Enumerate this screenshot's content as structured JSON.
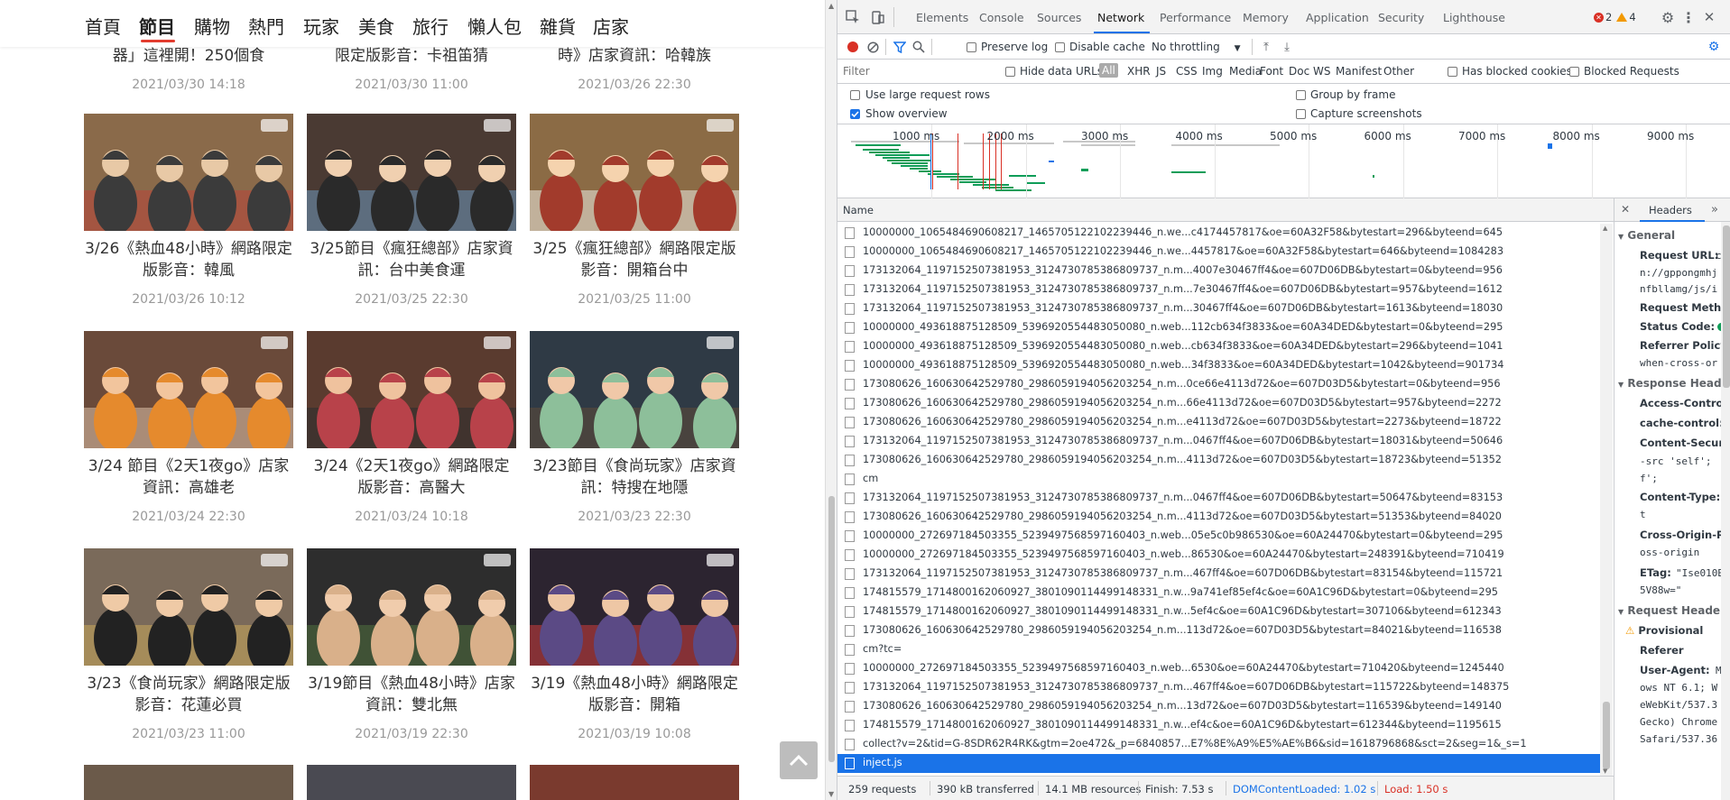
{
  "nav": {
    "items": [
      "首頁",
      "節目",
      "購物",
      "熱門",
      "玩家",
      "美食",
      "旅行",
      "懶人包",
      "雜貨",
      "店家"
    ],
    "active_index": 1
  },
  "cards": [
    {
      "title": "器」這裡開！250個食",
      "date": "2021/03/30 14:18",
      "partial": true
    },
    {
      "title": "限定版影音：卡祖笛猜",
      "date": "2021/03/30 11:00",
      "partial": true
    },
    {
      "title": "時》店家資訊：哈韓族",
      "date": "2021/03/26 22:30",
      "partial": true
    },
    {
      "title": "3/26《熱血48小時》網路限定版影音：韓風",
      "date": "2021/03/26 10:12"
    },
    {
      "title": "3/25節目《瘋狂總部》店家資訊：台中美食運",
      "date": "2021/03/25 22:30"
    },
    {
      "title": "3/25《瘋狂總部》網路限定版影音：開箱台中",
      "date": "2021/03/25 11:00"
    },
    {
      "title": "3/24 節目《2天1夜go》店家資訊：高雄老",
      "date": "2021/03/24 22:30"
    },
    {
      "title": "3/24《2天1夜go》網路限定版影音：高醫大",
      "date": "2021/03/24 10:18"
    },
    {
      "title": "3/23節目《食尚玩家》店家資訊：特搜在地隱",
      "date": "2021/03/23 22:30"
    },
    {
      "title": "3/23《食尚玩家》網路限定版影音：花蓮必買",
      "date": "2021/03/23 11:00"
    },
    {
      "title": "3/19節目《熱血48小時》店家資訊：雙北無",
      "date": "2021/03/19 22:30"
    },
    {
      "title": "3/19《熱血48小時》網路限定版影音：開箱",
      "date": "2021/03/19 10:08"
    }
  ],
  "devtools": {
    "tabs": [
      "Elements",
      "Console",
      "Sources",
      "Network",
      "Performance",
      "Memory",
      "Application",
      "Security",
      "Lighthouse"
    ],
    "active_tab": "Network",
    "error_count": "2",
    "warning_count": "4",
    "toolbar": {
      "preserve_log": "Preserve log",
      "disable_cache": "Disable cache",
      "throttling": "No throttling"
    },
    "filter": {
      "placeholder": "Filter",
      "hide_data_urls": "Hide data URLs",
      "types": [
        "All",
        "XHR",
        "JS",
        "CSS",
        "Img",
        "Media",
        "Font",
        "Doc",
        "WS",
        "Manifest",
        "Other"
      ],
      "has_blocked_cookies": "Has blocked cookies",
      "blocked_requests": "Blocked Requests"
    },
    "options": {
      "large_rows": "Use large request rows",
      "group_by_frame": "Group by frame",
      "show_overview": "Show overview",
      "capture_screenshots": "Capture screenshots"
    },
    "overview_ticks": [
      "1000 ms",
      "2000 ms",
      "3000 ms",
      "4000 ms",
      "5000 ms",
      "6000 ms",
      "7000 ms",
      "8000 ms",
      "9000 ms"
    ],
    "column_name": "Name",
    "requests": [
      "10000000_1065484690608217_1465705122102239446_n.we...c4174457817&oe=60A32F58&bytestart=296&byteend=645",
      "10000000_1065484690608217_1465705122102239446_n.we...4457817&oe=60A32F58&bytestart=646&byteend=1084283",
      "173132064_1197152507381953_3124730785386809737_n.m...4007e30467ff4&oe=607D06DB&bytestart=0&byteend=956",
      "173132064_1197152507381953_3124730785386809737_n.m...7e30467ff4&oe=607D06DB&bytestart=957&byteend=1612",
      "173132064_1197152507381953_3124730785386809737_n.m...30467ff4&oe=607D06DB&bytestart=1613&byteend=18030",
      "10000000_493618875128509_5396920554483050080_n.web...112cb634f3833&oe=60A34DED&bytestart=0&byteend=295",
      "10000000_493618875128509_5396920554483050080_n.web...cb634f3833&oe=60A34DED&bytestart=296&byteend=1041",
      "10000000_493618875128509_5396920554483050080_n.web...34f3833&oe=60A34DED&bytestart=1042&byteend=901734",
      "173080626_160630642529780_2986059194056203254_n.m...0ce66e4113d72&oe=607D03D5&bytestart=0&byteend=956",
      "173080626_160630642529780_2986059194056203254_n.m...66e4113d72&oe=607D03D5&bytestart=957&byteend=2272",
      "173080626_160630642529780_2986059194056203254_n.m...e4113d72&oe=607D03D5&bytestart=2273&byteend=18722",
      "173132064_1197152507381953_3124730785386809737_n.m...0467ff4&oe=607D06DB&bytestart=18031&byteend=50646",
      "173080626_160630642529780_2986059194056203254_n.m...4113d72&oe=607D03D5&bytestart=18723&byteend=51352",
      "cm",
      "173132064_1197152507381953_3124730785386809737_n.m...0467ff4&oe=607D06DB&bytestart=50647&byteend=83153",
      "173080626_160630642529780_2986059194056203254_n.m...4113d72&oe=607D03D5&bytestart=51353&byteend=84020",
      "10000000_272697184503355_5239497568597160403_n.web...05e5c0b986530&oe=60A24470&bytestart=0&byteend=295",
      "10000000_272697184503355_5239497568597160403_n.web...86530&oe=60A24470&bytestart=248391&byteend=710419",
      "173132064_1197152507381953_3124730785386809737_n.m...467ff4&oe=607D06DB&bytestart=83154&byteend=115721",
      "174815579_1714800162060927_3801090114499148331_n.w...9a741ef85ef4c&oe=60A1C96D&bytestart=0&byteend=295",
      "174815579_1714800162060927_3801090114499148331_n.w...5ef4c&oe=60A1C96D&bytestart=307106&byteend=612343",
      "173080626_160630642529780_2986059194056203254_n.m...113d72&oe=607D03D5&bytestart=84021&byteend=116538",
      "cm?tc=",
      "10000000_272697184503355_5239497568597160403_n.web...6530&oe=60A24470&bytestart=710420&byteend=1245440",
      "173132064_1197152507381953_3124730785386809737_n.m...467ff4&oe=607D06DB&bytestart=115722&byteend=148375",
      "173080626_160630642529780_2986059194056203254_n.m...13d72&oe=607D03D5&bytestart=116539&byteend=149140",
      "174815579_1714800162060927_3801090114499148331_n.w...ef4c&oe=60A1C96D&bytestart=612344&byteend=1195615",
      "collect?v=2&tid=G-8SDR62R4RK&gtm=2oe472&_p=6840857...E7%8E%A9%E5%AE%B6&sid=1618796868&sct=2&seg=1&_s=1",
      "inject.js"
    ],
    "selected_request": "inject.js",
    "status": {
      "requests": "259 requests",
      "transferred": "390 kB transferred",
      "resources": "14.1 MB resources",
      "finish": "Finish: 7.53 s",
      "dcl": "DOMContentLoaded: 1.02 s",
      "load": "Load: 1.50 s"
    },
    "headers_panel": {
      "tab": "Headers",
      "general": "General",
      "request_url_key": "Request URL:",
      "request_url_val1": "c",
      "request_url_val2": "n://gppongmhj",
      "request_url_val3": "nfbllamg/js/i",
      "request_method_key": "Request Metho",
      "status_code_key": "Status Code:",
      "referrer_policy_key": "Referrer Policy:",
      "referrer_policy_val": "when-cross-or",
      "response_headers": "Response Header",
      "access_control_key": "Access-Control-",
      "cache_control_key": "cache-control:",
      "csp_key": "Content-Securit",
      "csp_val1": "-src 'self';",
      "csp_val2": "f';",
      "content_type_key": "Content-Type:",
      "content_type_val": "t",
      "corp_key": "Cross-Origin-Re",
      "corp_val": "oss-origin",
      "etag_key": "ETag:",
      "etag_val1": "\"Ise010B",
      "etag_val2": "5V88w=\"",
      "request_headers": "Request Headers",
      "provisional": "Provisional",
      "referer_key": "Referer",
      "user_agent_key": "User-Agent:",
      "ua_val0": "Mo",
      "ua_val1": "ows NT 6.1; W",
      "ua_val2": "eWebKit/537.3",
      "ua_val3": "Gecko) Chrome",
      "ua_val4": "Safari/537.36"
    }
  }
}
